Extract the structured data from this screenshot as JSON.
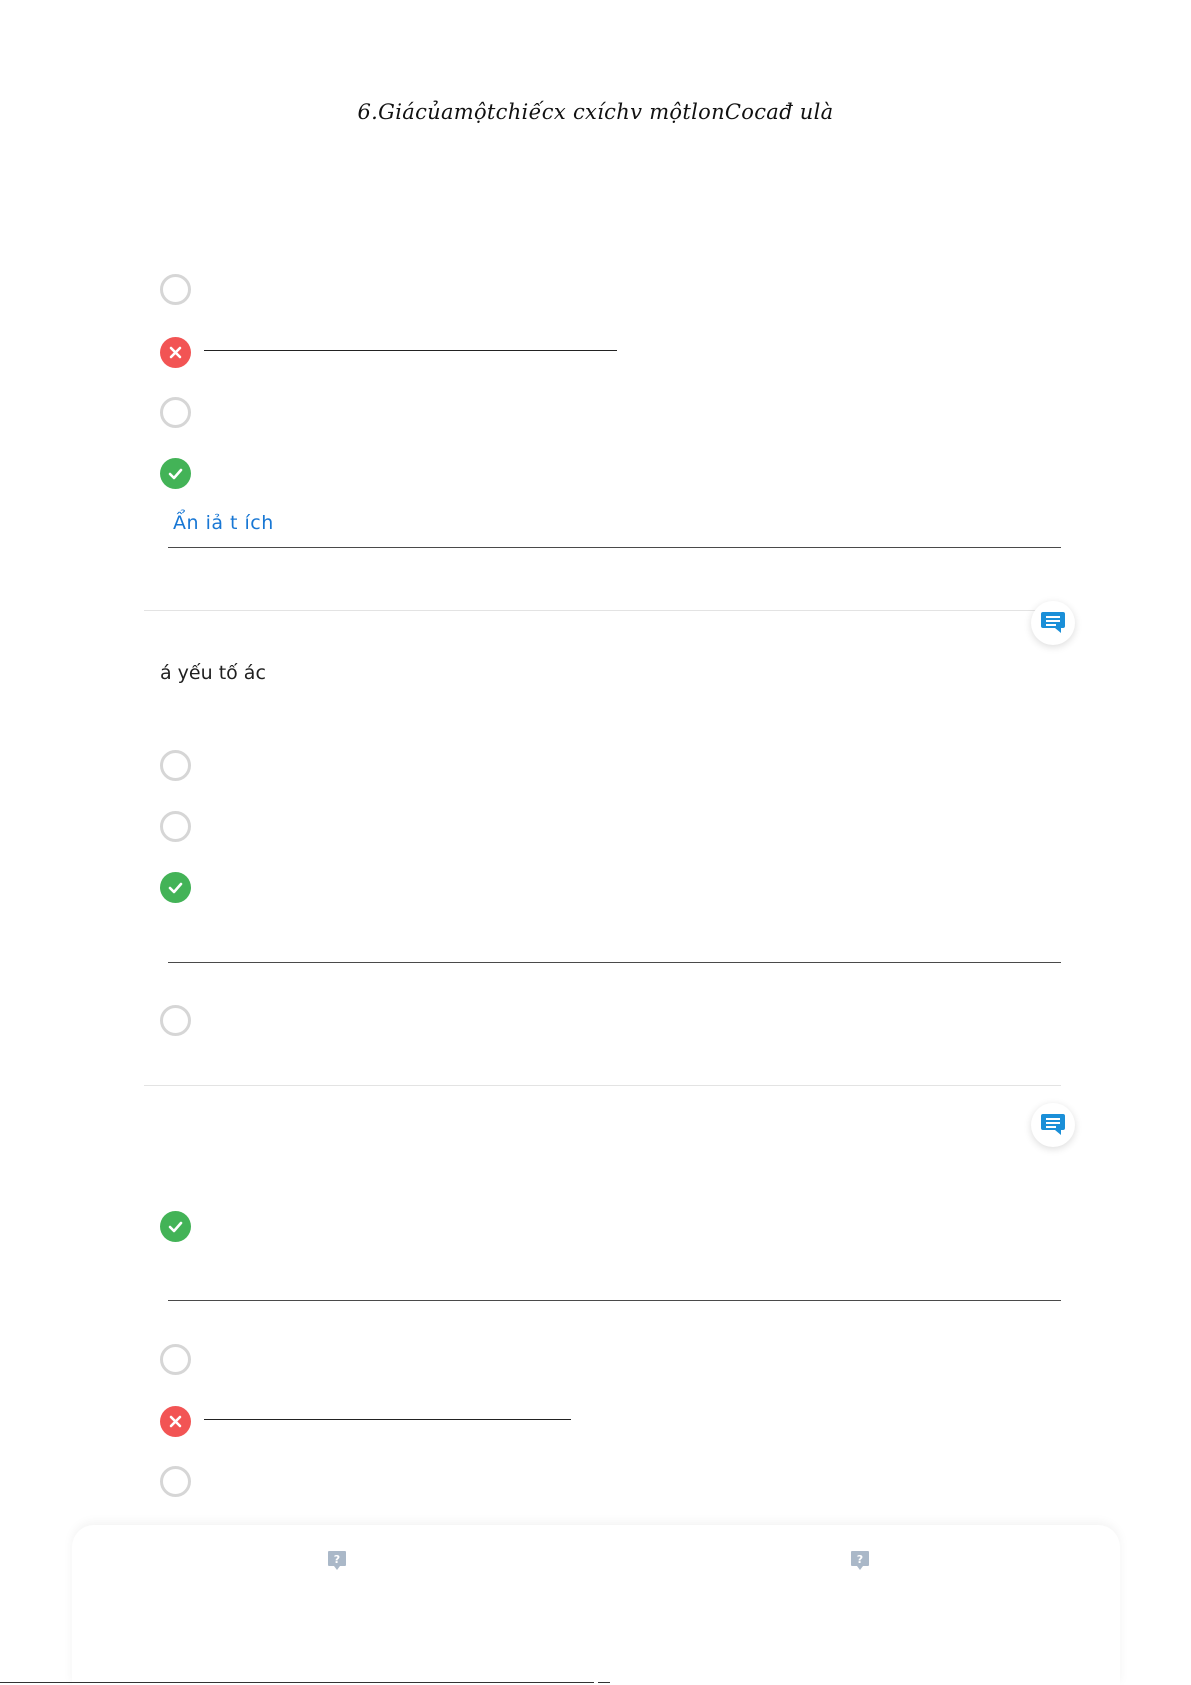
{
  "question6": {
    "title": "6.Giácủamộtchiếcx cxíchv mộtlonCocađ ulà"
  },
  "explanation": {
    "toggle_label": "Ẩn  iả  t  ích"
  },
  "question7": {
    "text": "á  yếu tố     ác"
  },
  "icons": {
    "wrong": "close-icon",
    "correct": "check-icon",
    "comment": "comment-icon",
    "help": "question-bubble-icon"
  },
  "colors": {
    "wrong": "#f25454",
    "correct": "#43b357",
    "link": "#1877d4",
    "comment": "#1a8fd8",
    "help": "#aab8c8"
  }
}
